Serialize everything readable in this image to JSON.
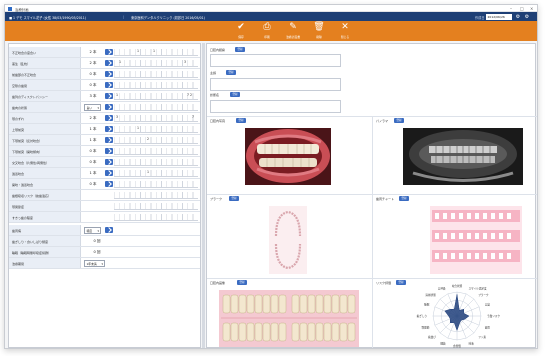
{
  "window": {
    "title": "治療計画",
    "controls": [
      "–",
      "□",
      "×"
    ]
  },
  "infobar": {
    "patient": "■ 1 デモ スマイル花子 (女性 38/03/1990/05/2011)",
    "clinic": "東京医科デンタルクリニック (初診日 2016/05/01)",
    "date_label": "作成日",
    "date_value": "2012/06/26"
  },
  "toolbar": {
    "buttons": [
      {
        "label": "保存",
        "glyph": "✔"
      },
      {
        "label": "印刷",
        "glyph": "⎙"
      },
      {
        "label": "治療計画書",
        "glyph": "✎"
      },
      {
        "label": "削除",
        "glyph": "🗑"
      },
      {
        "label": "閉じる",
        "glyph": "✕"
      }
    ]
  },
  "left_rows": [
    {
      "label": "不正咬合の度合い",
      "value": "2 本",
      "marks": [
        "1",
        "1"
      ]
    },
    {
      "label": "叢生（乱杭）",
      "value": "2 本",
      "marks": [
        "1",
        "3"
      ]
    },
    {
      "label": "前歯部の不正咬合",
      "value": "0 本",
      "marks": []
    },
    {
      "label": "空隙の歯間",
      "value": "0 本",
      "marks": []
    },
    {
      "label": "歯列のディスクレパンシー",
      "value": "3 本",
      "marks": [
        "1",
        "7 2"
      ]
    },
    {
      "label": "歯肉の状態",
      "select": "良い",
      "marks": []
    },
    {
      "label": "顎のずれ",
      "value": "2 本",
      "marks": [
        "3",
        "7"
      ]
    },
    {
      "label": "上顎前突",
      "value": "1 本",
      "marks": [
        "1"
      ]
    },
    {
      "label": "下顎前突（反対咬合）",
      "value": "1 本",
      "marks": [
        "2"
      ]
    },
    {
      "label": "下顎前突（開咬傾向）",
      "value": "0 本",
      "marks": []
    },
    {
      "label": "交叉咬合（片側性/両側性）",
      "value": "0 本",
      "marks": []
    },
    {
      "label": "過蓋咬合",
      "value": "1 本",
      "marks": [
        "1"
      ]
    },
    {
      "label": "開咬・過蓋咬合",
      "value": "0 本",
      "marks": []
    },
    {
      "label": "歯根吸収リスク（抜歯適応）",
      "value": "",
      "marks": []
    },
    {
      "label": "顎関節症",
      "value": "",
      "marks": []
    },
    {
      "label": "すきっ歯の程度",
      "value": "",
      "marks": []
    },
    {
      "label": "歯周病",
      "select": "軽度",
      "marks": []
    },
    {
      "label": "歯ぎしり・食いしばり頻度",
      "value": "0 回",
      "marks": []
    },
    {
      "label": "睡眠（睡眠時無呼吸症候群）",
      "value": "0 回",
      "marks": []
    },
    {
      "label": "治療期間",
      "select": "1年未満",
      "marks": []
    }
  ],
  "right": {
    "field1_label": "口腔内観察",
    "field2_label": "主訴",
    "field3_label": "診断名",
    "register": "登録",
    "photo1_label": "口腔内写真",
    "photo2_label": "パノラマ",
    "photo3_label": "プラーク",
    "photo4_label": "歯周チャート",
    "photo5_label": "口腔内画像",
    "photo6_label": "リスク評価"
  },
  "radar": {
    "axes": [
      "咬合状態",
      "スマイル満足度",
      "プラーク",
      "口臭",
      "う蝕リスク",
      "歯周",
      "フッ素",
      "唾液",
      "食習慣",
      "細菌",
      "歯並び",
      "顎関節",
      "歯ぎしり",
      "睡眠",
      "清掃状態",
      "口呼吸"
    ],
    "values": [
      0.9,
      0.25,
      0.4,
      0.3,
      0.5,
      0.35,
      0.25,
      0.3,
      0.6,
      0.3,
      0.4,
      0.3,
      0.35,
      0.55,
      0.4,
      0.3
    ]
  },
  "colors": {
    "toolbar": "#e4801f",
    "infobar": "#1e3f75",
    "accent": "#3a6bc1",
    "radar_fill": "#1f3e7a"
  }
}
